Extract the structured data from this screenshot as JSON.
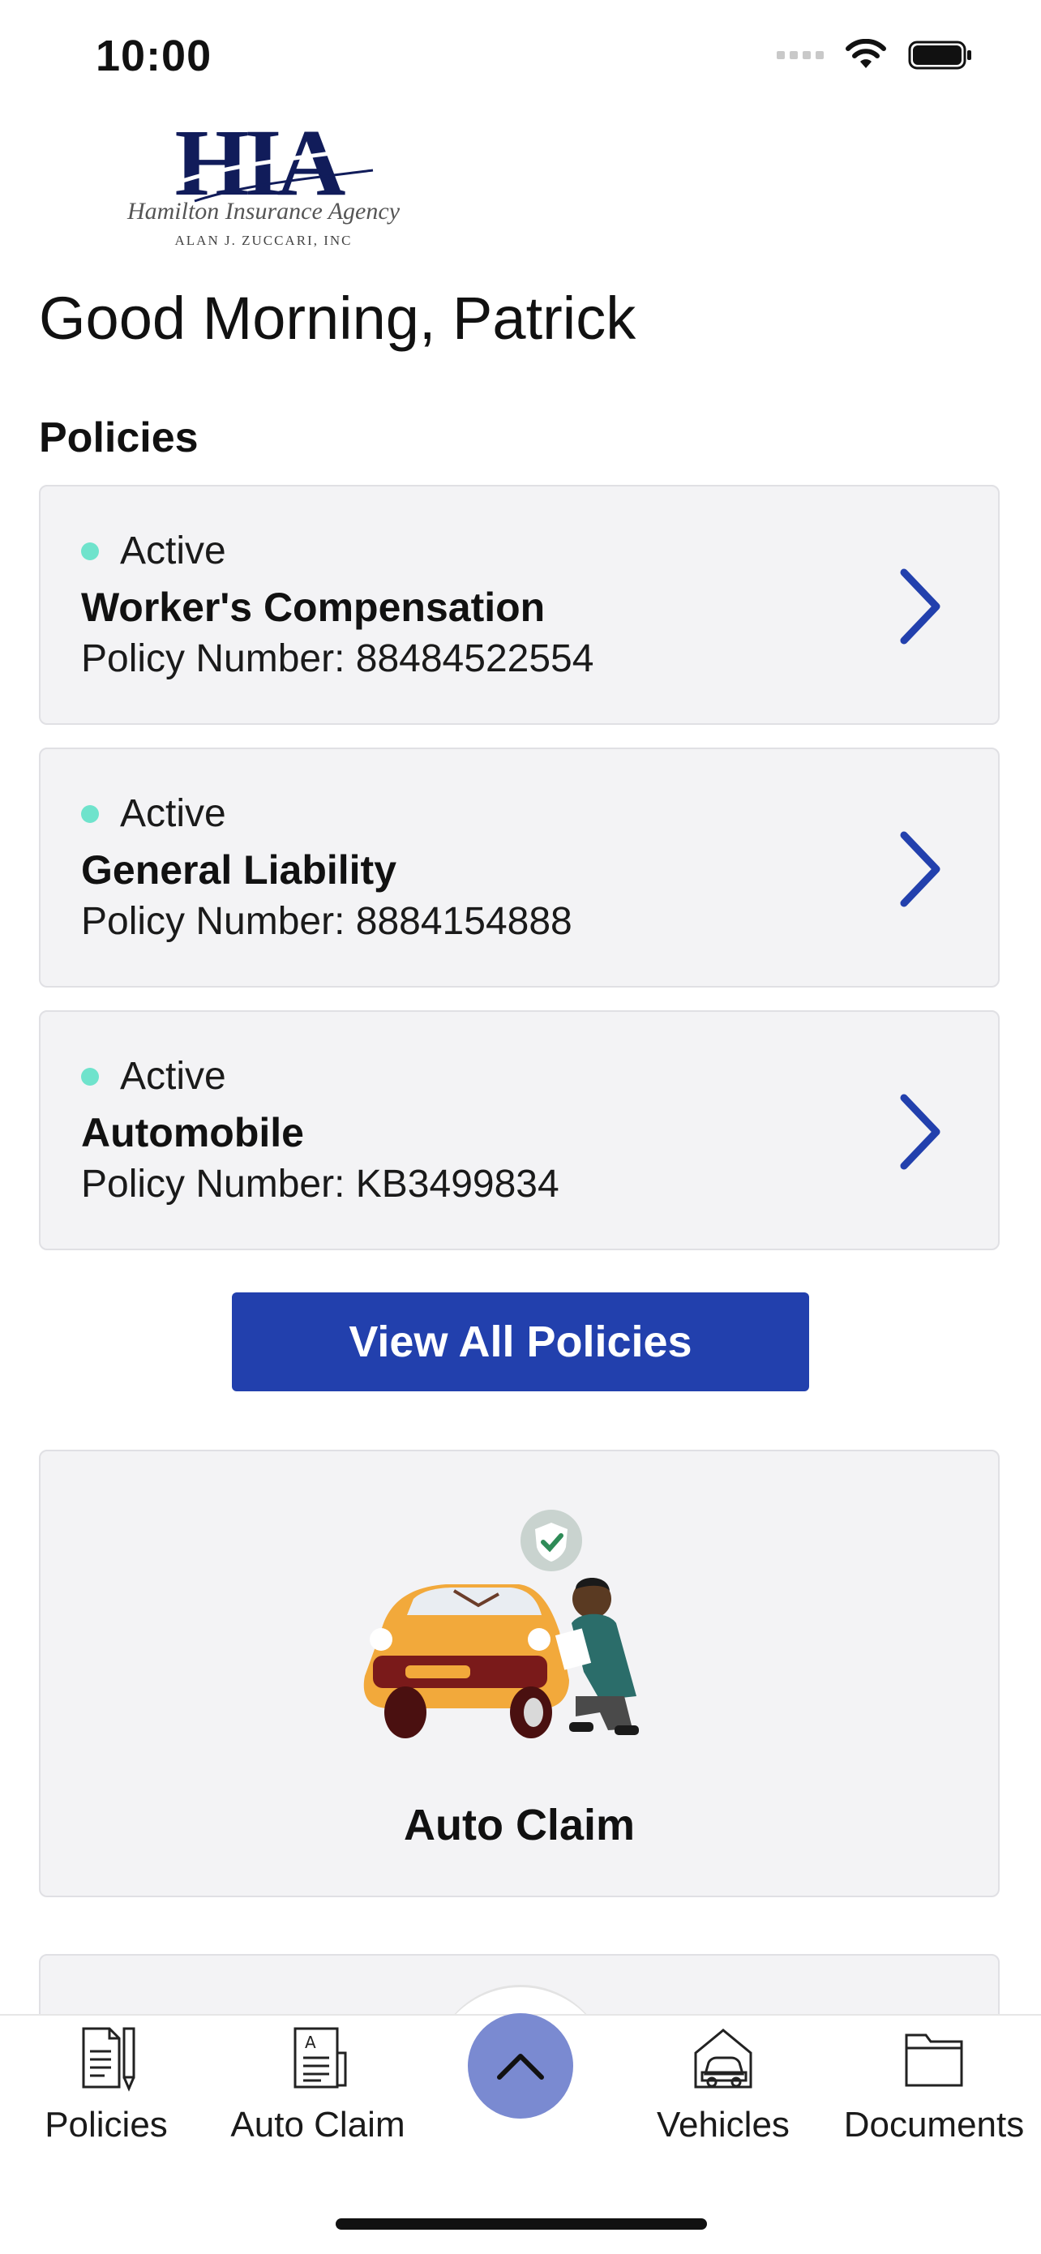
{
  "status_bar": {
    "time": "10:00"
  },
  "logo": {
    "mark": "HIA",
    "name": "Hamilton Insurance Agency",
    "tagline": "ALAN J. ZUCCARI, INC"
  },
  "greeting": "Good Morning, Patrick",
  "policies_title": "Policies",
  "policies": [
    {
      "status": "Active",
      "name": "Worker's Compensation",
      "number": "Policy Number: 88484522554"
    },
    {
      "status": "Active",
      "name": "General Liability",
      "number": "Policy Number: 8884154888"
    },
    {
      "status": "Active",
      "name": "Automobile",
      "number": "Policy Number: KB3499834"
    }
  ],
  "view_all_label": "View All Policies",
  "claim_card": {
    "label": "Auto Claim"
  },
  "tabs": [
    {
      "label": "Policies",
      "icon": "policy-document-icon"
    },
    {
      "label": "Auto Claim",
      "icon": "claim-form-icon"
    },
    {
      "label": "Vehicles",
      "icon": "car-garage-icon"
    },
    {
      "label": "Documents",
      "icon": "folder-icon"
    }
  ],
  "colors": {
    "accent": "#2240ad",
    "active_dot": "#6fe3cc",
    "fab": "#7a8ad1",
    "card_bg": "#f3f3f5"
  }
}
